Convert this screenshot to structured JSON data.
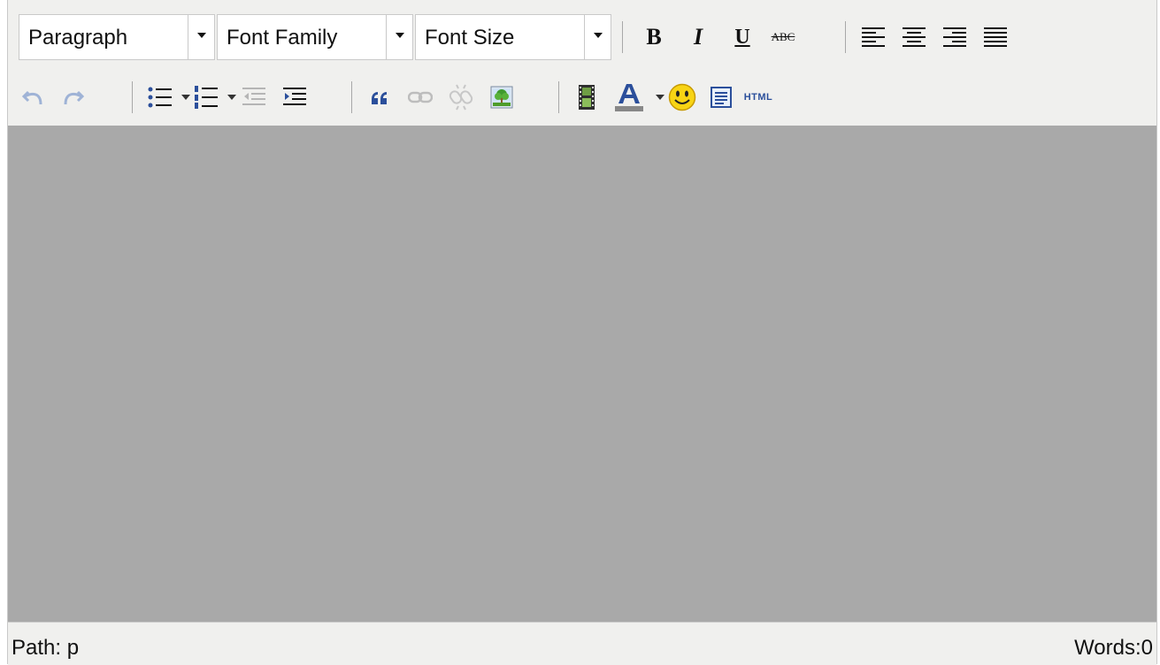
{
  "toolbar": {
    "block_format": "Paragraph",
    "font_family": "Font Family",
    "font_size": "Font Size",
    "bold_label": "B",
    "italic_label": "I",
    "underline_label": "U",
    "strike_label": "ABC",
    "html_label": "HTML"
  },
  "status": {
    "path": "Path: p",
    "words": "Words:0"
  },
  "colors": {
    "toolbar_bg": "#f0f0ee",
    "content_bg": "#a9a9a9",
    "text_color_underline": "#888888"
  }
}
